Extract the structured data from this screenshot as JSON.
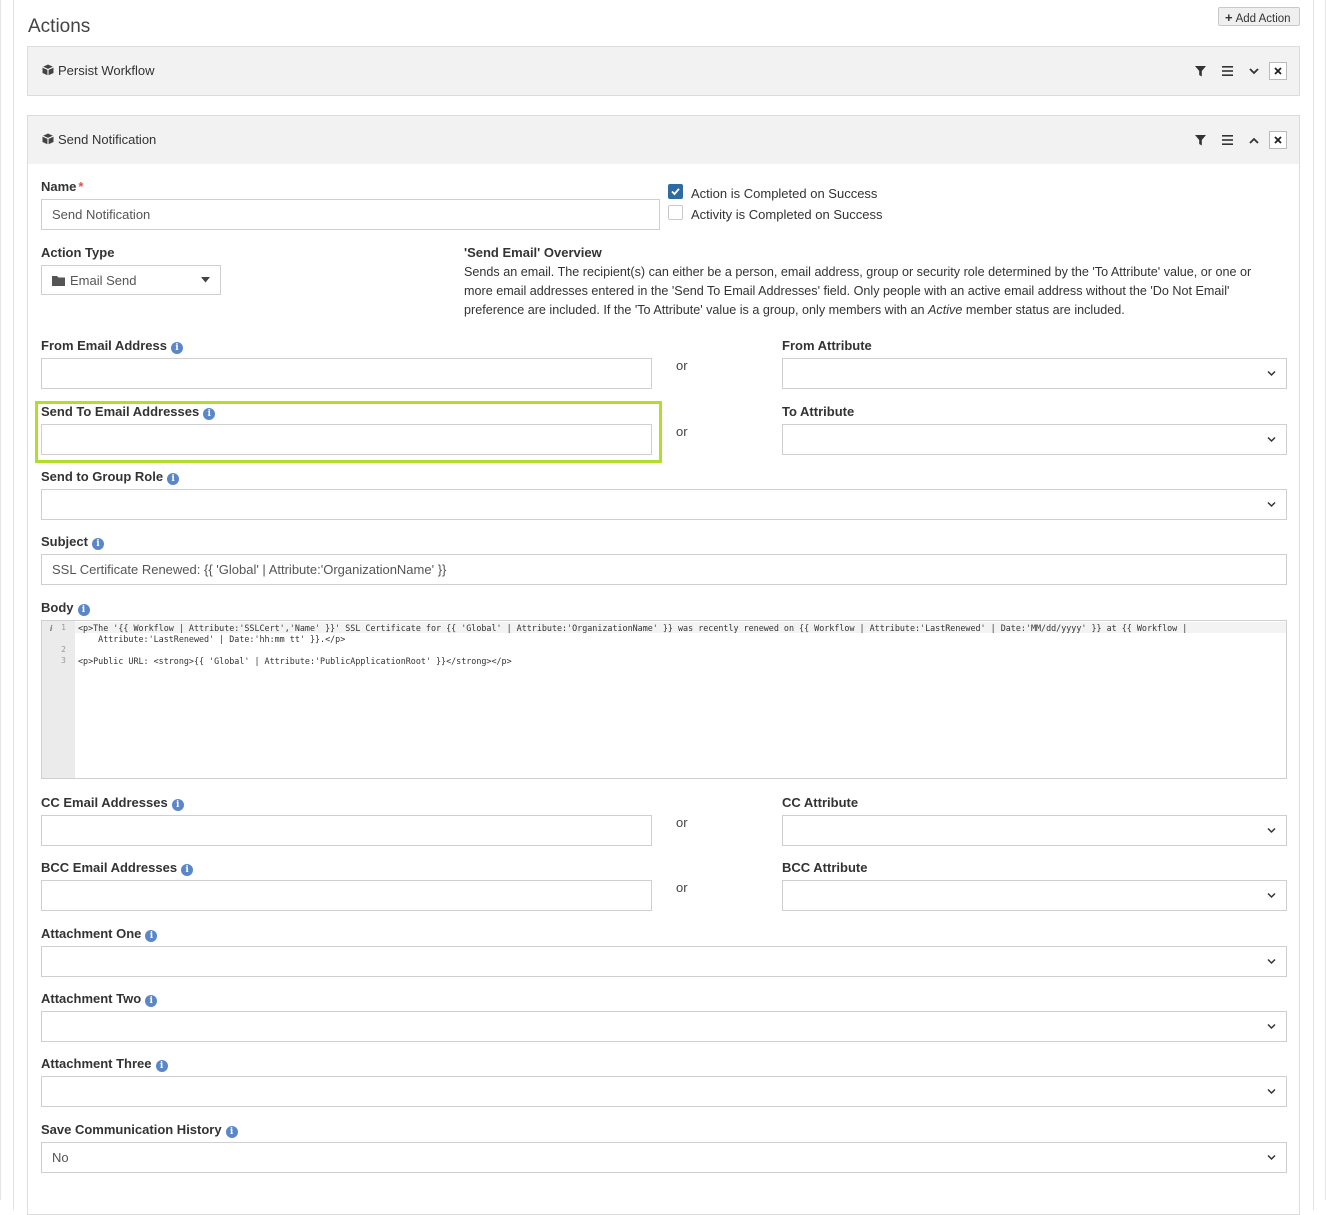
{
  "page": {
    "title": "Actions",
    "add_action_label": "Add Action"
  },
  "panels": {
    "persist": {
      "title": "Persist Workflow"
    },
    "send": {
      "title": "Send Notification"
    }
  },
  "form": {
    "name": {
      "label": "Name",
      "value": "Send Notification"
    },
    "checkboxes": {
      "action_completed": {
        "label": "Action is Completed on Success",
        "checked": true
      },
      "activity_completed": {
        "label": "Activity is Completed on Success",
        "checked": false
      }
    },
    "action_type": {
      "label": "Action Type",
      "value": "Email Send"
    },
    "overview": {
      "title": "'Send Email' Overview",
      "text_1": "Sends an email. The recipient(s) can either be a person, email address, group or security role determined by the 'To Attribute' value, or one or more email addresses entered in the 'Send To Email Addresses' field. Only people with an active email address without the 'Do Not Email' preference are included. If the 'To Attribute' value is a group, only members with an ",
      "text_em": "Active",
      "text_2": " member status are included."
    },
    "or_text": "or",
    "from_email": {
      "label": "From Email Address",
      "value": ""
    },
    "from_attribute": {
      "label": "From Attribute",
      "value": ""
    },
    "send_to_emails": {
      "label": "Send To Email Addresses",
      "value": ""
    },
    "to_attribute": {
      "label": "To Attribute",
      "value": ""
    },
    "group_role": {
      "label": "Send to Group Role",
      "value": ""
    },
    "subject": {
      "label": "Subject",
      "value": "SSL Certificate Renewed: {{ 'Global' | Attribute:'OrganizationName' }}"
    },
    "body": {
      "label": "Body",
      "line_numbers": [
        "1",
        "2",
        "3"
      ],
      "line1a": "<p>The '{{ Workflow | Attribute:'SSLCert','Name' }}' SSL Certificate for {{ 'Global' | Attribute:'OrganizationName' }} was recently renewed on {{ Workflow | Attribute:'LastRenewed' | Date:'MM/dd/yyyy' }} at {{ Workflow |",
      "line1b": "    Attribute:'LastRenewed' | Date:'hh:mm tt' }}.</p>",
      "line3": "<p>Public URL: <strong>{{ 'Global' | Attribute:'PublicApplicationRoot' }}</strong></p>"
    },
    "cc_emails": {
      "label": "CC Email Addresses",
      "value": ""
    },
    "cc_attribute": {
      "label": "CC Attribute",
      "value": ""
    },
    "bcc_emails": {
      "label": "BCC Email Addresses",
      "value": ""
    },
    "bcc_attribute": {
      "label": "BCC Attribute",
      "value": ""
    },
    "attachment_one": {
      "label": "Attachment One",
      "value": ""
    },
    "attachment_two": {
      "label": "Attachment Two",
      "value": ""
    },
    "attachment_three": {
      "label": "Attachment Three",
      "value": ""
    },
    "save_history": {
      "label": "Save Communication History",
      "value": "No"
    }
  },
  "colors": {
    "highlight": "#b3dd2b",
    "checkbox": "#2d6ca2",
    "info": "#5b87c7",
    "required": "#d9534f"
  }
}
